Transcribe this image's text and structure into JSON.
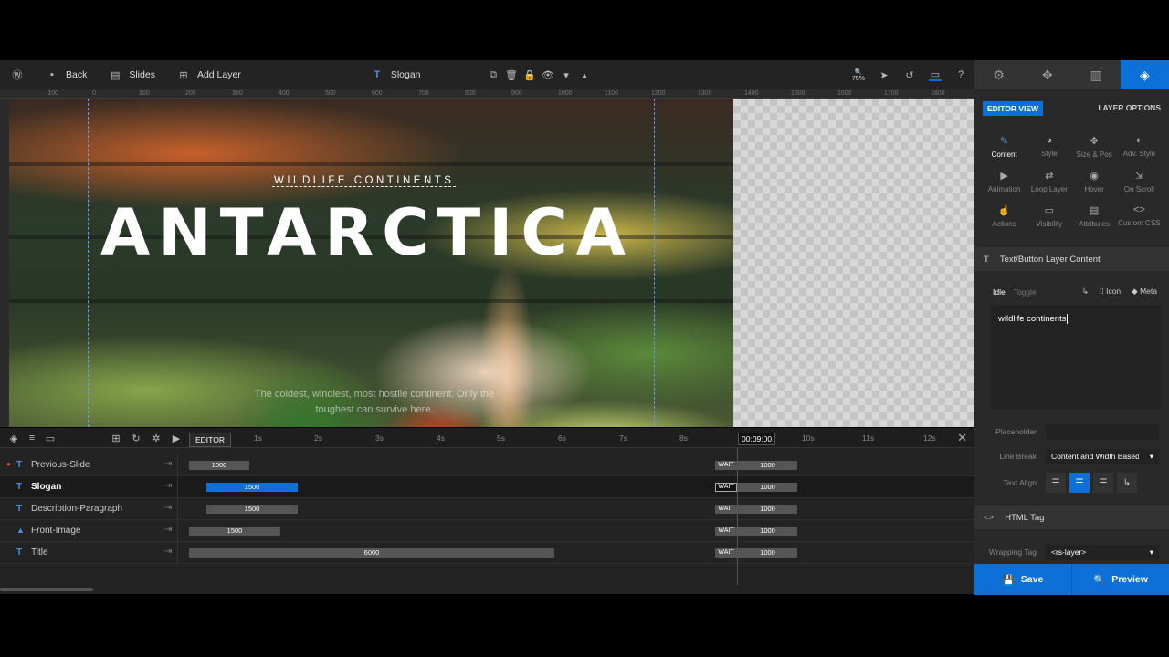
{
  "toolbar": {
    "back": "Back",
    "slides": "Slides",
    "add_layer": "Add Layer",
    "current_layer": "Slogan",
    "zoom": "75%"
  },
  "ruler": [
    "-100",
    "0",
    "100",
    "200",
    "300",
    "400",
    "500",
    "600",
    "700",
    "800",
    "900",
    "1000",
    "1100",
    "1200",
    "1300",
    "1400",
    "1500",
    "1600",
    "1700",
    "1800"
  ],
  "canvas": {
    "slogan": "wildlife continents",
    "title": "ANTARCTICA",
    "description": "The coldest, windiest, most hostile continent. Only the toughest can survive here."
  },
  "timeline": {
    "editor_tab": "EDITOR",
    "seconds": [
      "1s",
      "2s",
      "3s",
      "4s",
      "5s",
      "6s",
      "7s",
      "8s",
      "10s",
      "11s",
      "12s"
    ],
    "current_time": "00:09:00",
    "wait_label": "WAIT",
    "rows": [
      {
        "label": "Previous-Slide",
        "start": "1000",
        "end": "1000"
      },
      {
        "label": "Slogan",
        "start": "1500",
        "end": "1000"
      },
      {
        "label": "Description-Paragraph",
        "start": "1500",
        "end": "1000"
      },
      {
        "label": "Front-Image",
        "start": "1500",
        "end": "1000"
      },
      {
        "label": "Title",
        "start": "6000",
        "end": "1000"
      }
    ]
  },
  "panel": {
    "editor_view": "EDITOR VIEW",
    "layer_options": "LAYER OPTIONS",
    "options": [
      "Content",
      "Style",
      "Size & Pos",
      "Adv. Style",
      "Animation",
      "Loop Layer",
      "Hover",
      "On Scroll",
      "Actions",
      "Visibility",
      "Attributes",
      "Custom CSS"
    ],
    "section_content": "Text/Button Layer Content",
    "tab_idle": "Idle",
    "tab_toggle": "Toggle",
    "icon_label": "Icon",
    "meta_label": "Meta",
    "content_value": "wildlife continents",
    "placeholder_label": "Placeholder",
    "placeholder_value": "",
    "line_break_label": "Line Break",
    "line_break_value": "Content and Width Based",
    "text_align_label": "Text Align",
    "section_html": "HTML Tag",
    "wrapping_tag_label": "Wrapping Tag",
    "wrapping_tag_value": "<rs-layer>",
    "save": "Save",
    "preview": "Preview"
  }
}
